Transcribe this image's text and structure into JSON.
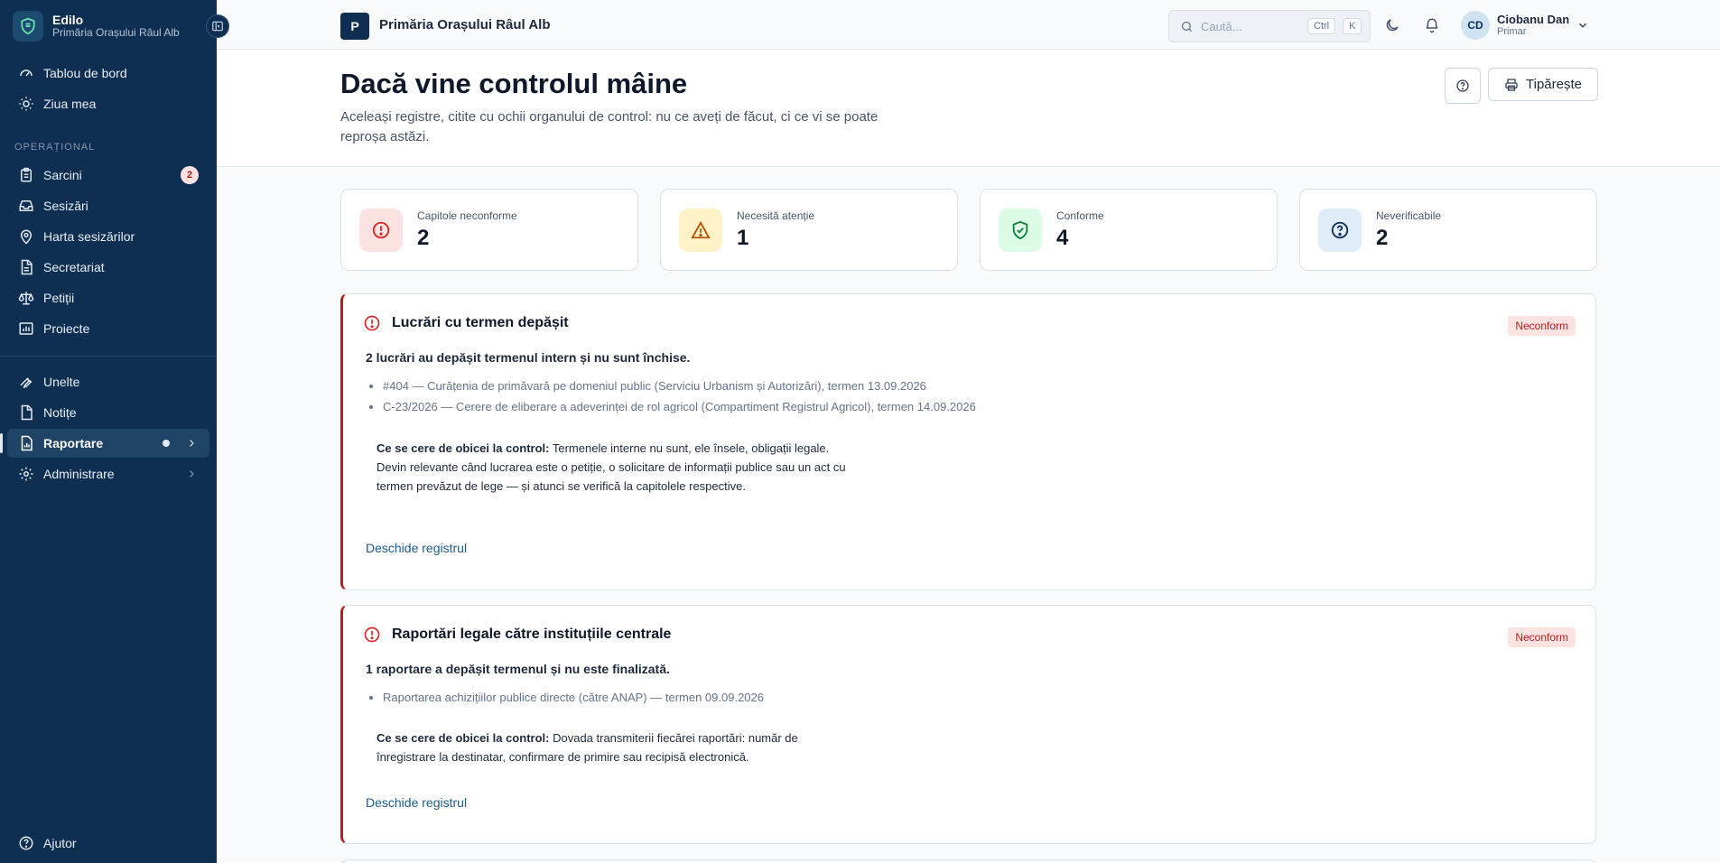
{
  "app": {
    "name": "Edilo",
    "org": "Primăria Orașului Râul Alb"
  },
  "sidebar": {
    "top_items": [
      {
        "label": "Tablou de bord",
        "icon": "dashboard-icon"
      },
      {
        "label": "Ziua mea",
        "icon": "sun-icon"
      }
    ],
    "section_label": "OPERAȚIONAL",
    "ops_items": [
      {
        "label": "Sarcini",
        "icon": "clipboard-icon",
        "badge": "2"
      },
      {
        "label": "Sesizări",
        "icon": "inbox-icon"
      },
      {
        "label": "Harta sesizărilor",
        "icon": "map-pin-icon"
      },
      {
        "label": "Secretariat",
        "icon": "document-icon"
      },
      {
        "label": "Petiții",
        "icon": "scale-icon"
      },
      {
        "label": "Proiecte",
        "icon": "chart-icon"
      }
    ],
    "tool_items": [
      {
        "label": "Unelte",
        "icon": "wrench-icon"
      },
      {
        "label": "Notițe",
        "icon": "note-icon"
      },
      {
        "label": "Raportare",
        "icon": "report-icon",
        "active": true
      },
      {
        "label": "Administrare",
        "icon": "gear-icon"
      }
    ],
    "help_label": "Ajutor"
  },
  "header": {
    "org_initial": "P",
    "org_name": "Primăria Orașului Râul Alb",
    "search_placeholder": "Caută...",
    "kbd_ctrl": "Ctrl",
    "kbd_k": "K",
    "user": {
      "initials": "CD",
      "name": "Ciobanu Dan",
      "role": "Primar"
    }
  },
  "page": {
    "title": "Dacă vine controlul mâine",
    "subtitle": "Aceleași registre, citite cu ochii organului de control: nu ce aveți de făcut, ci ce vi se poate reproșa astăzi.",
    "print_label": "Tipărește"
  },
  "stats": [
    {
      "label": "Capitole neconforme",
      "value": "2",
      "color": "#dc2626",
      "bg": "#fde2e2",
      "icon": "alert-circle-icon"
    },
    {
      "label": "Necesită atenție",
      "value": "1",
      "color": "#b45309",
      "bg": "#fef3c7",
      "icon": "warning-icon"
    },
    {
      "label": "Conforme",
      "value": "4",
      "color": "#15803d",
      "bg": "#dcfce7",
      "icon": "shield-check-icon"
    },
    {
      "label": "Neverificabile",
      "value": "2",
      "color": "#0f2f52",
      "bg": "#e0ecf8",
      "icon": "question-icon"
    }
  ],
  "sections": [
    {
      "title": "Lucrări cu termen depășit",
      "status": "Neconform",
      "summary": "2 lucrări au depășit termenul intern și nu sunt închise.",
      "items": [
        "#404 — Curățenia de primăvară pe domeniul public (Serviciu Urbanism și Autorizări), termen 13.09.2026",
        "C-23/2026 — Cerere de eliberare a adeverinței de rol agricol (Compartiment Registrul Agricol), termen 14.09.2026"
      ],
      "note_label": "Ce se cere de obicei la control:",
      "note": "Termenele interne nu sunt, ele însele, obligații legale. Devin relevante când lucrarea este o petiție, o solicitare de informații publice sau un act cu termen prevăzut de lege — și atunci se verifică la capitolele respective.",
      "link": "Deschide registrul"
    },
    {
      "title": "Raportări legale către instituțiile centrale",
      "status": "Neconform",
      "summary": "1 raportare a depășit termenul și nu este finalizată.",
      "items": [
        "Raportarea achizițiilor publice directe (către ANAP) — termen 09.09.2026"
      ],
      "note_label": "Ce se cere de obicei la control:",
      "note": "Dovada transmiterii fiecărei raportări: număr de înregistrare la destinatar, confirmare de primire sau recipisă electronică.",
      "link": "Deschide registrul"
    }
  ]
}
